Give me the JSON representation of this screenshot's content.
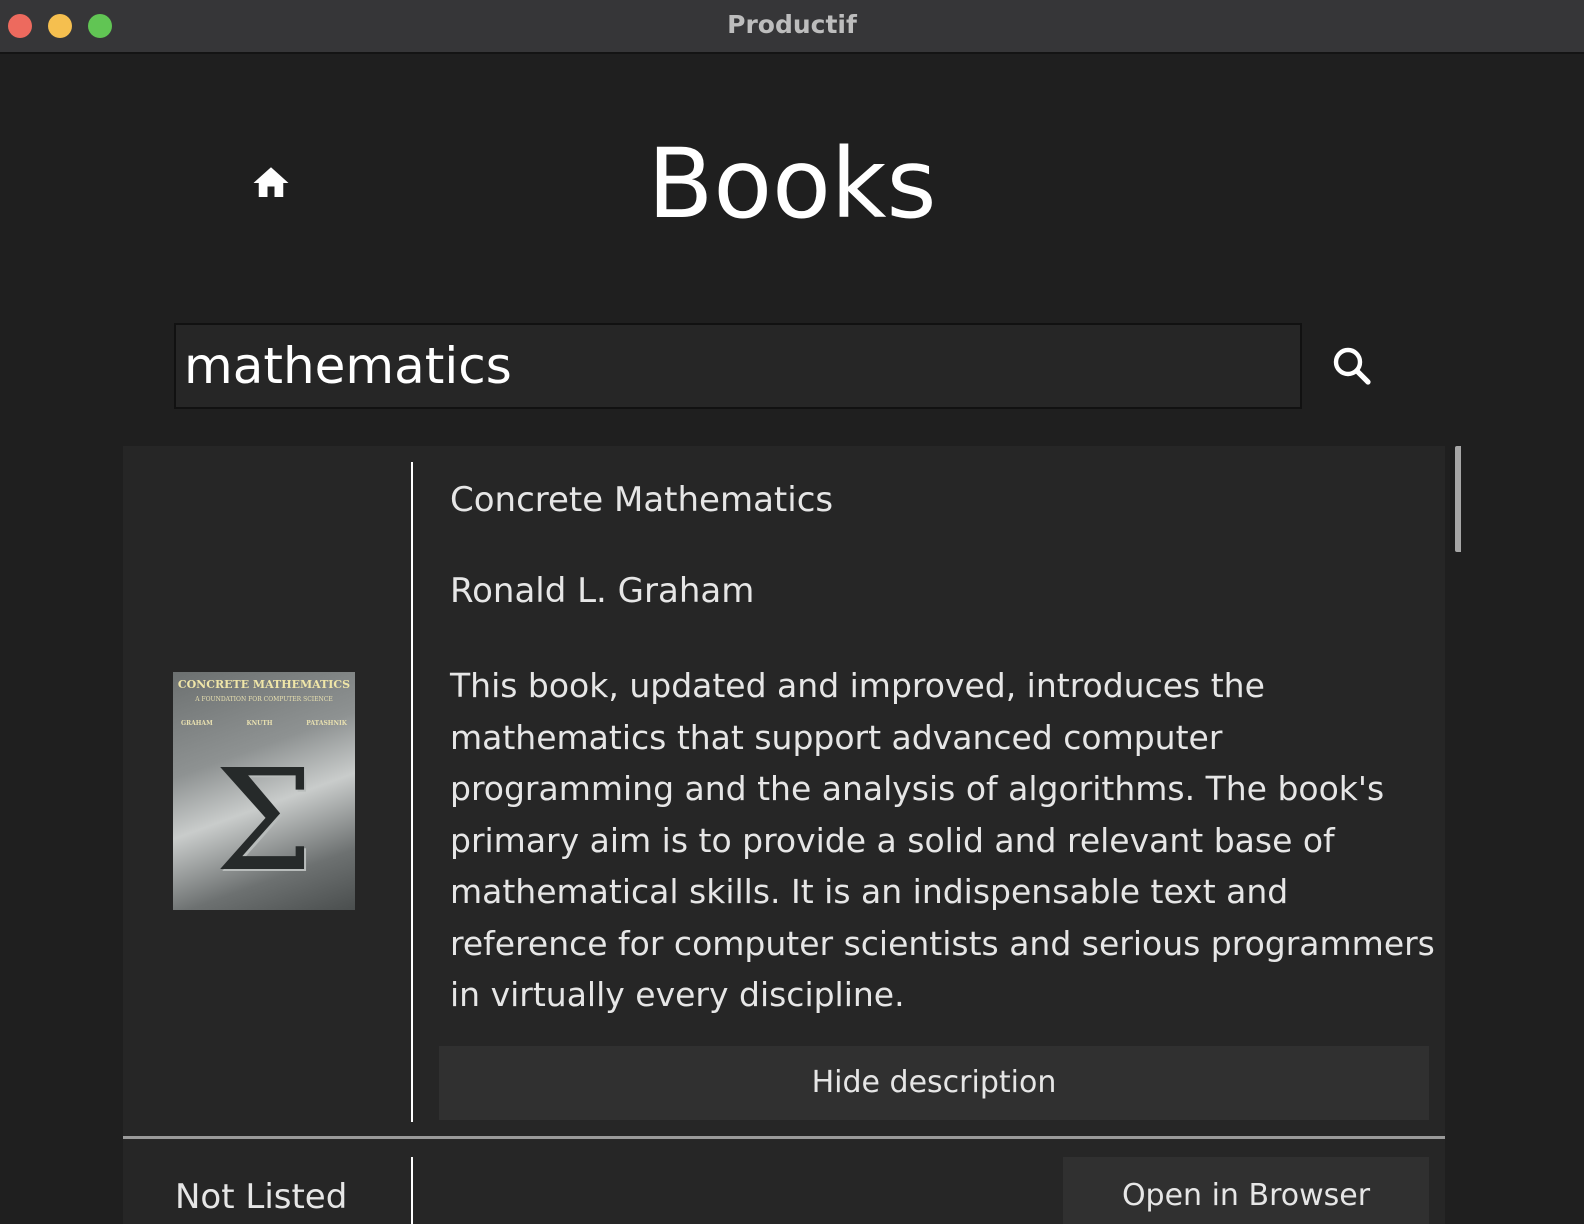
{
  "window": {
    "title": "Productif"
  },
  "header": {
    "title": "Books",
    "home_icon": "home-icon"
  },
  "search": {
    "value": "mathematics",
    "icon": "search-icon"
  },
  "results": [
    {
      "title": "Concrete Mathematics",
      "author": "Ronald L. Graham",
      "description": "This book, updated and improved, introduces the mathematics that support advanced computer programming and the analysis of algorithms. The book's primary aim is to provide a solid and relevant base of mathematical skills. It is an indispensable text and reference for computer scientists and serious programmers in virtually every discipline.",
      "toggle_description_label": "Hide description",
      "cover": {
        "title": "CONCRETE MATHEMATICS",
        "subtitle": "A FOUNDATION FOR COMPUTER SCIENCE",
        "authors": [
          "GRAHAM",
          "KNUTH",
          "PATASHNIK"
        ],
        "symbol": "Σ"
      }
    },
    {
      "status": "Not Listed",
      "open_label": "Open in Browser"
    }
  ],
  "colors": {
    "background": "#1f1f1f",
    "card": "#262626",
    "button": "#303030",
    "text": "#e6e6e6",
    "close": "#ed6a5e",
    "minimize": "#f5bf4f",
    "zoom": "#61c554"
  }
}
